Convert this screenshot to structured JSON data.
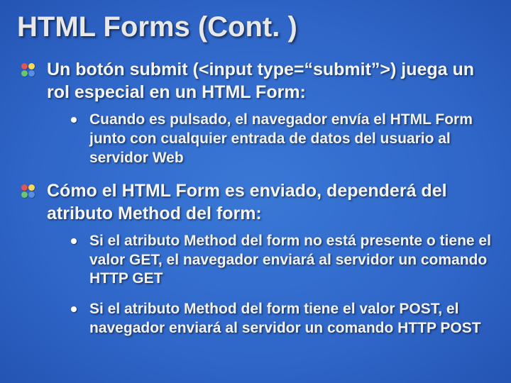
{
  "title": "HTML Forms (Cont. )",
  "items": [
    {
      "text": "Un botón submit (<input type=“submit”>) juega un rol especial en un HTML Form:",
      "subs": [
        "Cuando es pulsado, el navegador envía el HTML Form junto con cualquier entrada de datos del usuario al servidor Web"
      ]
    },
    {
      "text": "Cómo el HTML Form es enviado, dependerá del atributo Method del form:",
      "subs": [
        "Si el atributo Method del form no está presente o tiene el valor GET, el navegador enviará al servidor un comando HTTP GET",
        "Si el atributo Method del form tiene el valor POST, el navegador enviará al servidor un comando HTTP POST"
      ]
    }
  ]
}
